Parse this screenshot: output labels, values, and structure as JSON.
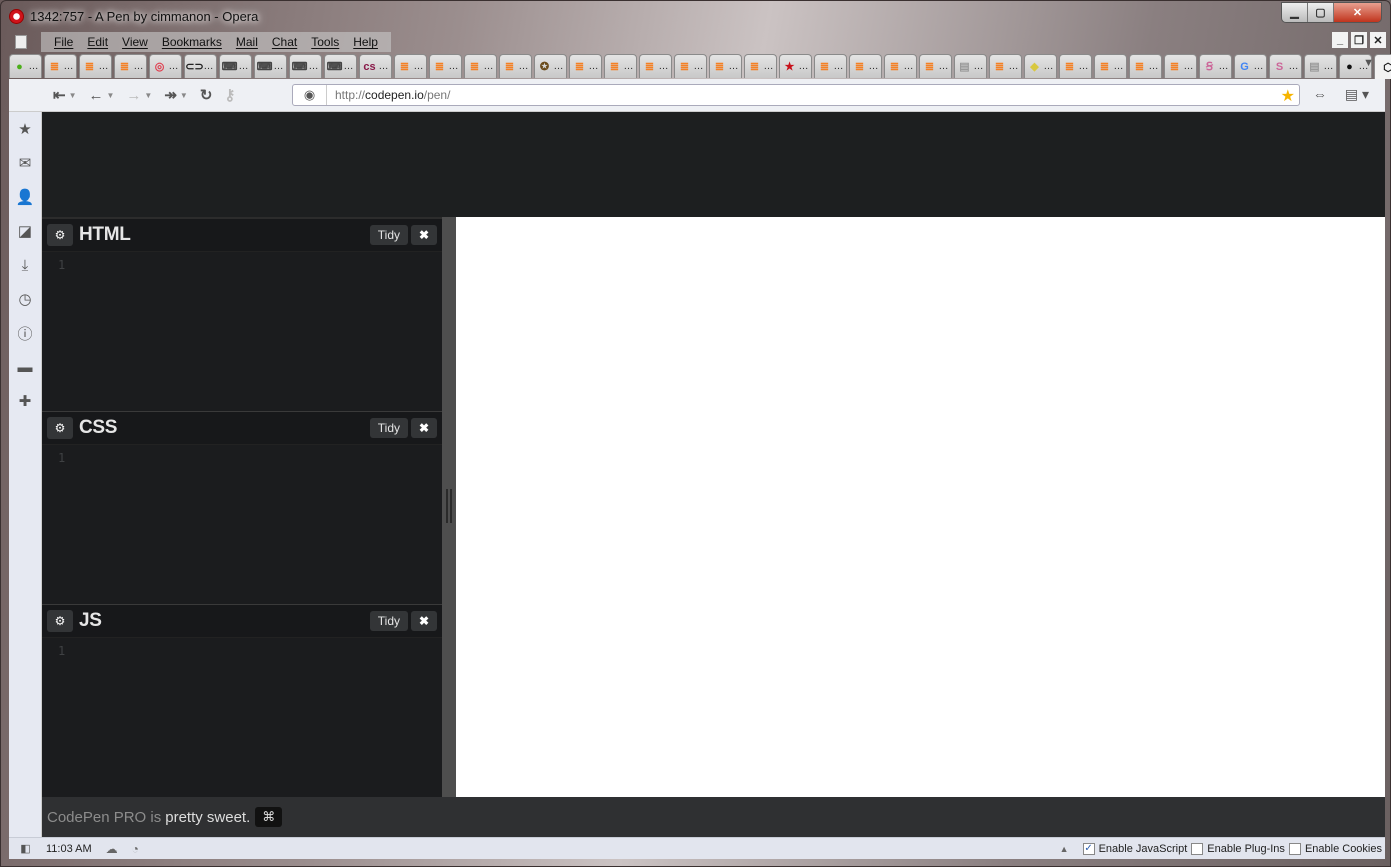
{
  "window": {
    "title": "1342:757 - A Pen by cimmanon - Opera",
    "controls": {
      "minimize": "▁",
      "maximize": "▢",
      "close": "✕"
    },
    "mdi_controls": {
      "minimize": "_",
      "restore": "❐",
      "close": "✕"
    }
  },
  "menubar": {
    "items": [
      "File",
      "Edit",
      "View",
      "Bookmarks",
      "Mail",
      "Chat",
      "Tools",
      "Help"
    ]
  },
  "tabs": [
    {
      "icon": "green-dot-icon",
      "glyph": "●",
      "color": "#4caf1a"
    },
    {
      "icon": "stackoverflow-icon",
      "glyph": "≣",
      "color": "#f48024"
    },
    {
      "icon": "stackoverflow-icon",
      "glyph": "≣",
      "color": "#f48024"
    },
    {
      "icon": "stackoverflow-icon",
      "glyph": "≣",
      "color": "#f48024"
    },
    {
      "icon": "red-circle-logo-icon",
      "glyph": "◎",
      "color": "#e04050"
    },
    {
      "icon": "link-chain-icon",
      "glyph": "⊂⊃",
      "color": "#222"
    },
    {
      "icon": "gamepad-icon",
      "glyph": "⌨",
      "color": "#444"
    },
    {
      "icon": "gamepad-icon",
      "glyph": "⌨",
      "color": "#444"
    },
    {
      "icon": "gamepad-icon",
      "glyph": "⌨",
      "color": "#444"
    },
    {
      "icon": "gamepad-icon",
      "glyph": "⌨",
      "color": "#444"
    },
    {
      "icon": "css-badge-icon",
      "glyph": "cs",
      "color": "#8a1a4a"
    },
    {
      "icon": "stackoverflow-icon",
      "glyph": "≣",
      "color": "#f48024"
    },
    {
      "icon": "stackoverflow-icon",
      "glyph": "≣",
      "color": "#f48024"
    },
    {
      "icon": "stackoverflow-icon",
      "glyph": "≣",
      "color": "#f48024"
    },
    {
      "icon": "stackoverflow-icon",
      "glyph": "≣",
      "color": "#f48024"
    },
    {
      "icon": "emblem-icon",
      "glyph": "✪",
      "color": "#6a4a1a"
    },
    {
      "icon": "stackoverflow-icon",
      "glyph": "≣",
      "color": "#f48024"
    },
    {
      "icon": "stackoverflow-icon",
      "glyph": "≣",
      "color": "#f48024"
    },
    {
      "icon": "stackoverflow-icon",
      "glyph": "≣",
      "color": "#f48024"
    },
    {
      "icon": "stackoverflow-icon",
      "glyph": "≣",
      "color": "#f48024"
    },
    {
      "icon": "stackoverflow-icon",
      "glyph": "≣",
      "color": "#f48024"
    },
    {
      "icon": "stackoverflow-icon",
      "glyph": "≣",
      "color": "#f48024"
    },
    {
      "icon": "red-star-icon",
      "glyph": "★",
      "color": "#c8101a"
    },
    {
      "icon": "stackoverflow-icon",
      "glyph": "≣",
      "color": "#f48024"
    },
    {
      "icon": "stackoverflow-icon",
      "glyph": "≣",
      "color": "#f48024"
    },
    {
      "icon": "stackoverflow-icon",
      "glyph": "≣",
      "color": "#f48024"
    },
    {
      "icon": "stackoverflow-icon",
      "glyph": "≣",
      "color": "#f48024"
    },
    {
      "icon": "document-icon",
      "glyph": "▤",
      "color": "#999"
    },
    {
      "icon": "stackoverflow-icon",
      "glyph": "≣",
      "color": "#f48024"
    },
    {
      "icon": "tag-icon",
      "glyph": "◆",
      "color": "#d8c840"
    },
    {
      "icon": "stackoverflow-icon",
      "glyph": "≣",
      "color": "#f48024"
    },
    {
      "icon": "stackoverflow-icon",
      "glyph": "≣",
      "color": "#f48024"
    },
    {
      "icon": "stackoverflow-icon",
      "glyph": "≣",
      "color": "#f48024"
    },
    {
      "icon": "stackoverflow-icon",
      "glyph": "≣",
      "color": "#f48024"
    },
    {
      "icon": "sass-icon",
      "glyph": "Ꞩ",
      "color": "#cc6699"
    },
    {
      "icon": "google-icon",
      "glyph": "G",
      "color": "#4285f4"
    },
    {
      "icon": "sass-icon",
      "glyph": "S",
      "color": "#cc6699"
    },
    {
      "icon": "document-icon",
      "glyph": "▤",
      "color": "#999"
    },
    {
      "icon": "github-icon",
      "glyph": "●",
      "color": "#111"
    },
    {
      "icon": "codepen-icon",
      "glyph": "⬡",
      "color": "#111",
      "active": true
    }
  ],
  "tab_ellipsis": "…",
  "navbar": {
    "url_scheme": "http://",
    "url_host": "codepen.io",
    "url_path": "/pen/"
  },
  "sidepanel": [
    "bookmarks-star-icon",
    "mail-icon",
    "contacts-icon",
    "notes-icon",
    "downloads-icon",
    "history-clock-icon",
    "info-icon",
    "chat-bubble-icon",
    "add-panel-icon"
  ],
  "editors": [
    {
      "title": "HTML",
      "tidy": "Tidy",
      "line": "1"
    },
    {
      "title": "CSS",
      "tidy": "Tidy",
      "line": "1"
    },
    {
      "title": "JS",
      "tidy": "Tidy",
      "line": "1"
    }
  ],
  "footer": {
    "prefix": "CodePen PRO is",
    "suffix": "pretty sweet.",
    "cmd": "⌘"
  },
  "statusbar": {
    "time": "11:03 AM",
    "enable_js": {
      "label": "Enable JavaScript",
      "checked": true
    },
    "enable_plugins": {
      "label": "Enable Plug-Ins",
      "checked": false
    },
    "enable_cookies": {
      "label": "Enable Cookies",
      "checked": false
    }
  }
}
